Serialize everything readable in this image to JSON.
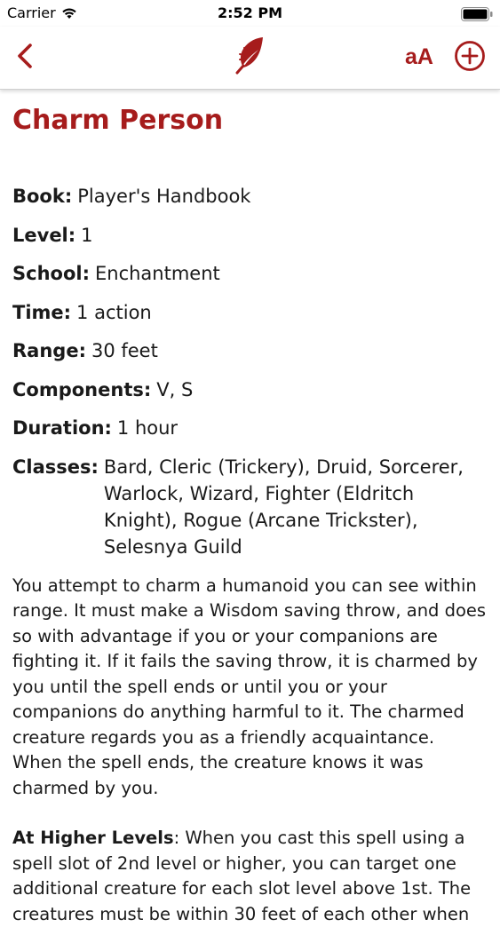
{
  "status_bar": {
    "carrier": "Carrier",
    "time": "2:52 PM"
  },
  "nav": {
    "font_size_label": "aA",
    "accent_color": "#a61c1c"
  },
  "spell": {
    "name": "Charm Person",
    "properties": [
      {
        "label": "Book:",
        "value": "Player's Handbook"
      },
      {
        "label": "Level:",
        "value": "1"
      },
      {
        "label": "School:",
        "value": "Enchantment"
      },
      {
        "label": "Time:",
        "value": "1 action"
      },
      {
        "label": "Range:",
        "value": "30 feet"
      },
      {
        "label": "Components:",
        "value": "V, S"
      },
      {
        "label": "Duration:",
        "value": "1 hour"
      },
      {
        "label": "Classes:",
        "value": "Bard, Cleric (Trickery), Druid, Sorcerer, Warlock, Wizard, Fighter (Eldritch Knight), Rogue (Arcane Trickster), Selesnya Guild"
      }
    ],
    "description": "You attempt to charm a humanoid you can see within range. It must make a Wisdom saving throw, and does so with advantage if you or your companions are fighting it. If it fails the saving throw, it is charmed by you until the spell ends or until you or your companions do anything harmful to it. The charmed creature regards you as a friendly acquaintance. When the spell ends, the creature knows it was charmed by you.",
    "higher_levels_label": "At Higher Levels",
    "higher_levels_text": ": When you cast this spell using a spell slot of 2nd level or higher, you can target one additional creature for each slot level above 1st. The creatures must be within 30 feet of each other when"
  }
}
